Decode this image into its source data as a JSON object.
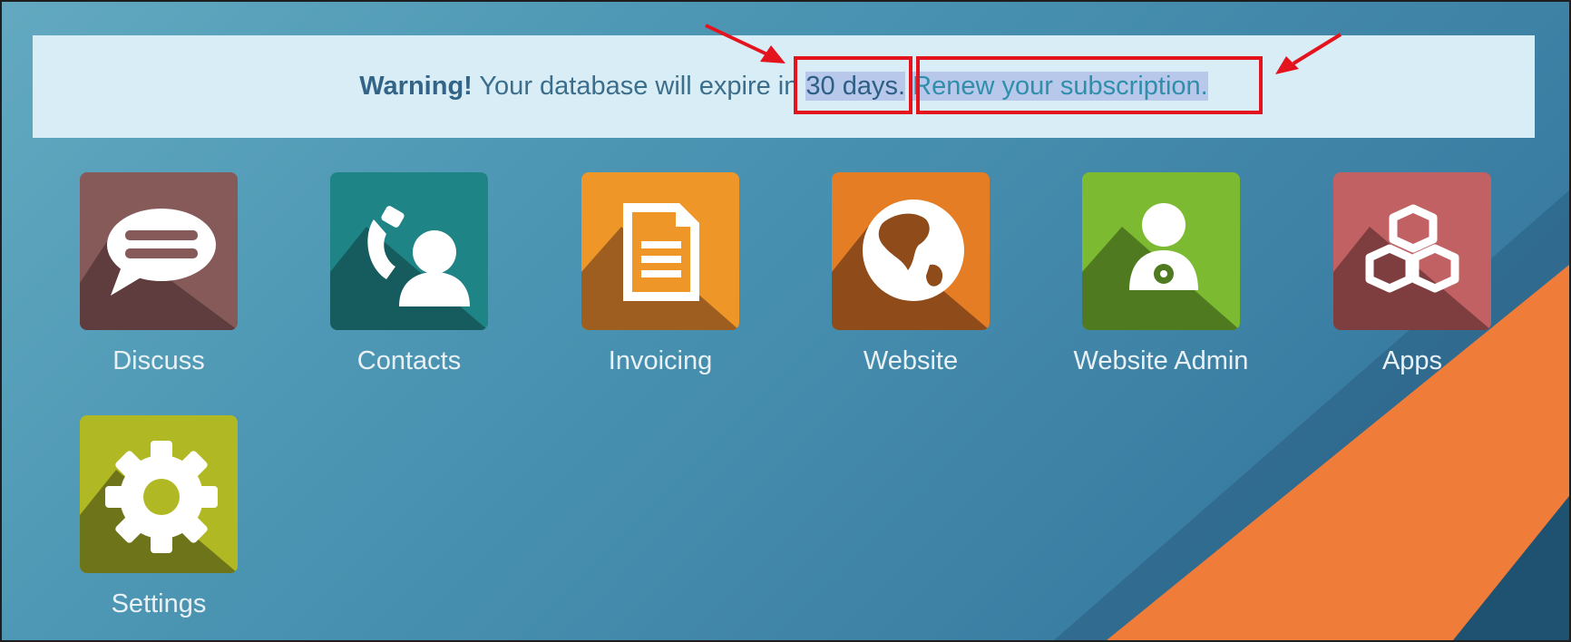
{
  "banner": {
    "warning_label": "Warning!",
    "message": "Your database will expire in",
    "days": "30 days",
    "period": ".",
    "renew_link": "Renew your subscription",
    "renew_period": "."
  },
  "apps": [
    {
      "label": "Discuss",
      "color": "#875a5a",
      "icon": "chat-bubble-icon"
    },
    {
      "label": "Contacts",
      "color": "#1e8485",
      "icon": "contact-phone-icon"
    },
    {
      "label": "Invoicing",
      "color": "#ef9629",
      "icon": "document-icon"
    },
    {
      "label": "Website",
      "color": "#e57d25",
      "icon": "globe-icon"
    },
    {
      "label": "Website Admin",
      "color": "#7cba31",
      "icon": "user-gear-icon"
    },
    {
      "label": "Apps",
      "color": "#c26163",
      "icon": "cubes-icon"
    },
    {
      "label": "Settings",
      "color": "#b0b823",
      "icon": "gear-icon"
    }
  ],
  "colors": {
    "annotation_red": "#e3141e",
    "banner_bg": "#d9edf6",
    "background_accent": "#f07c3a"
  }
}
